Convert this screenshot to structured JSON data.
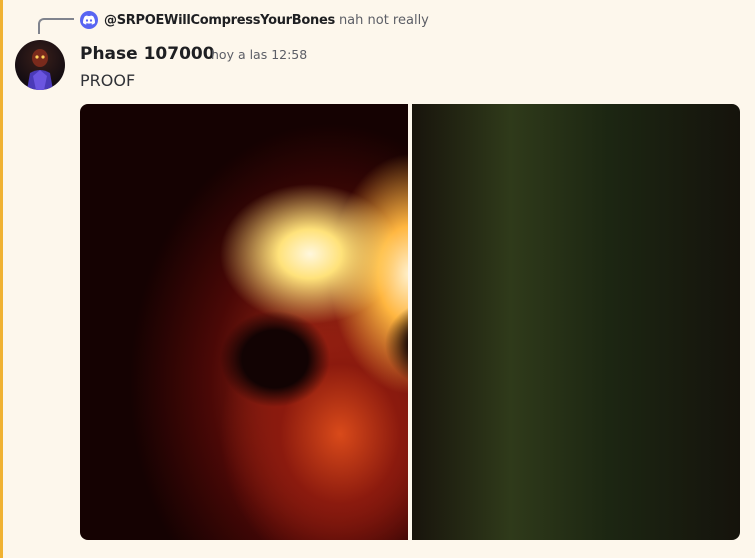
{
  "reply": {
    "author": "@SRPOEWillCompressYourBones",
    "content": "nah not really"
  },
  "message": {
    "author": "Phase 107000",
    "timestamp": "hoy a las 12:58",
    "content": "PROOF"
  },
  "colors": {
    "highlight_bar": "#f0b232",
    "message_background": "#fdf7ec",
    "reply_avatar": "#5865f2"
  },
  "icons": {
    "reply_avatar": "discord-logo-icon",
    "avatar": "user-avatar"
  }
}
